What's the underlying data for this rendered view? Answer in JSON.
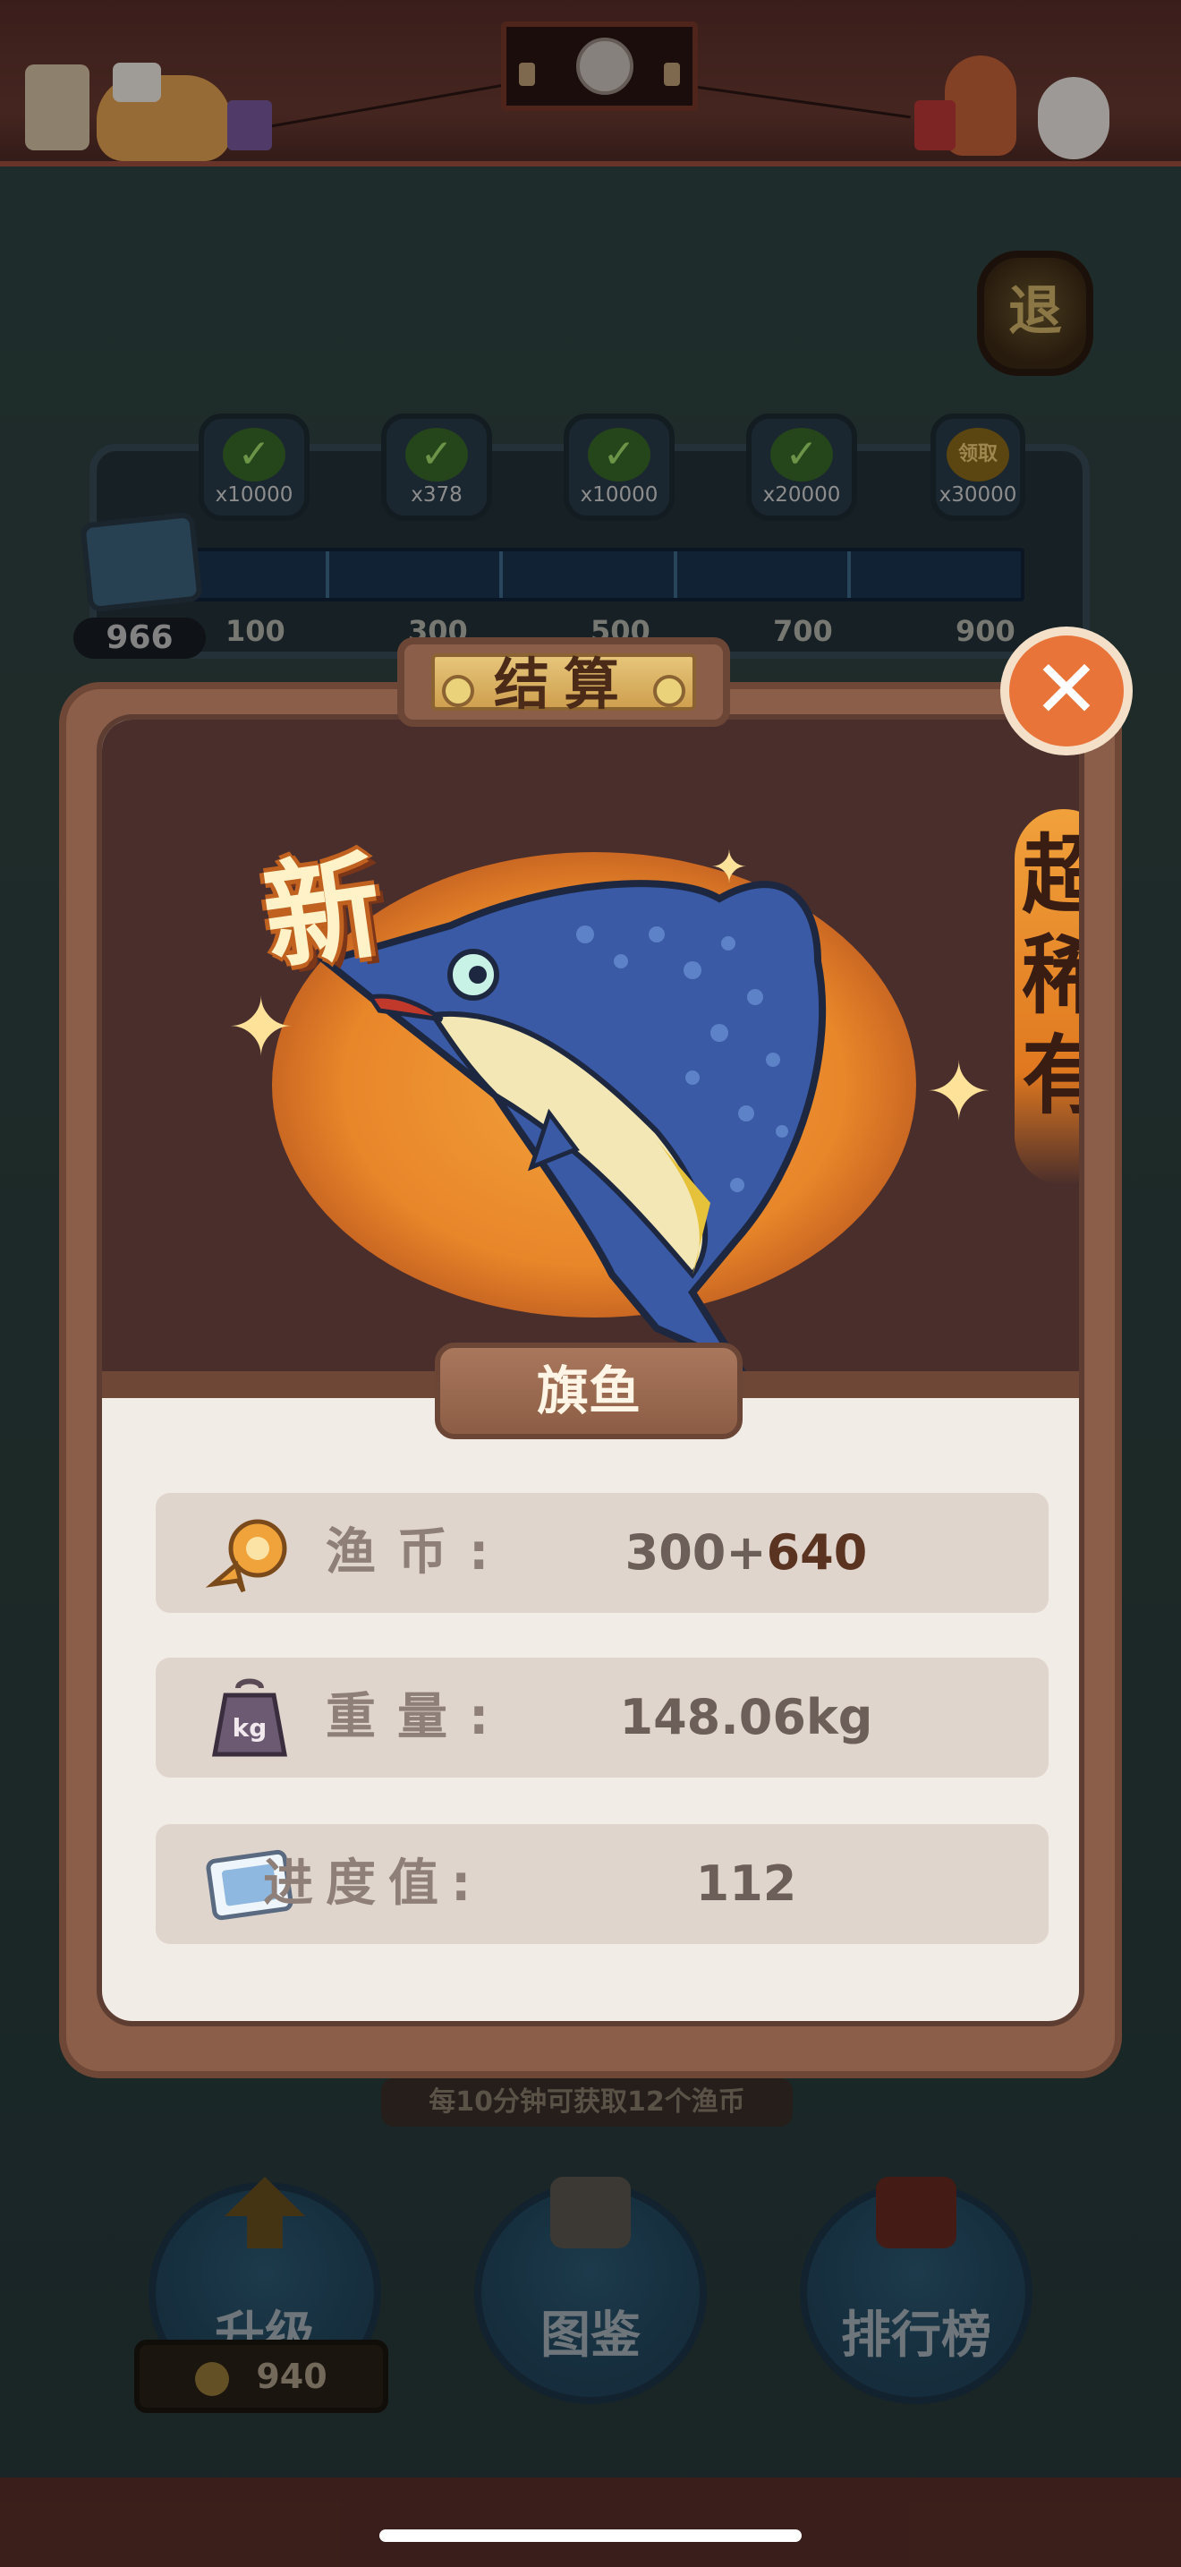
{
  "header": {
    "exit_label": "退"
  },
  "reward_track": {
    "points": "966",
    "milestones": [
      {
        "status": "claimed",
        "amount": "x10000"
      },
      {
        "status": "claimed",
        "amount": "x378"
      },
      {
        "status": "claimed",
        "amount": "x10000"
      },
      {
        "status": "claimed",
        "amount": "x20000"
      },
      {
        "status": "claimable",
        "claim_label": "领取",
        "amount": "x30000"
      }
    ],
    "ticks": [
      "100",
      "300",
      "500",
      "700",
      "900"
    ]
  },
  "modal": {
    "title": "结算",
    "new_badge": "新",
    "rarity": "超稀有",
    "fish_name": "旗鱼",
    "stats": [
      {
        "icon": "fish-coin-icon",
        "label": "渔币:",
        "base": "300+",
        "bonus": "640"
      },
      {
        "icon": "weight-kg-icon",
        "label": "重量:",
        "value": "148.06kg"
      },
      {
        "icon": "progress-ticket-icon",
        "label": "进度值:",
        "value": "112"
      }
    ]
  },
  "hint": "每10分钟可获取12个渔币",
  "bottom_buttons": {
    "upgrade": "升级",
    "upgrade_cost": "940",
    "collection": "图鉴",
    "leaderboard": "排行榜"
  },
  "colors": {
    "accent_orange": "#e9743a",
    "panel_brown": "#8a5e48",
    "rarity_orange": "#f1a13b"
  }
}
